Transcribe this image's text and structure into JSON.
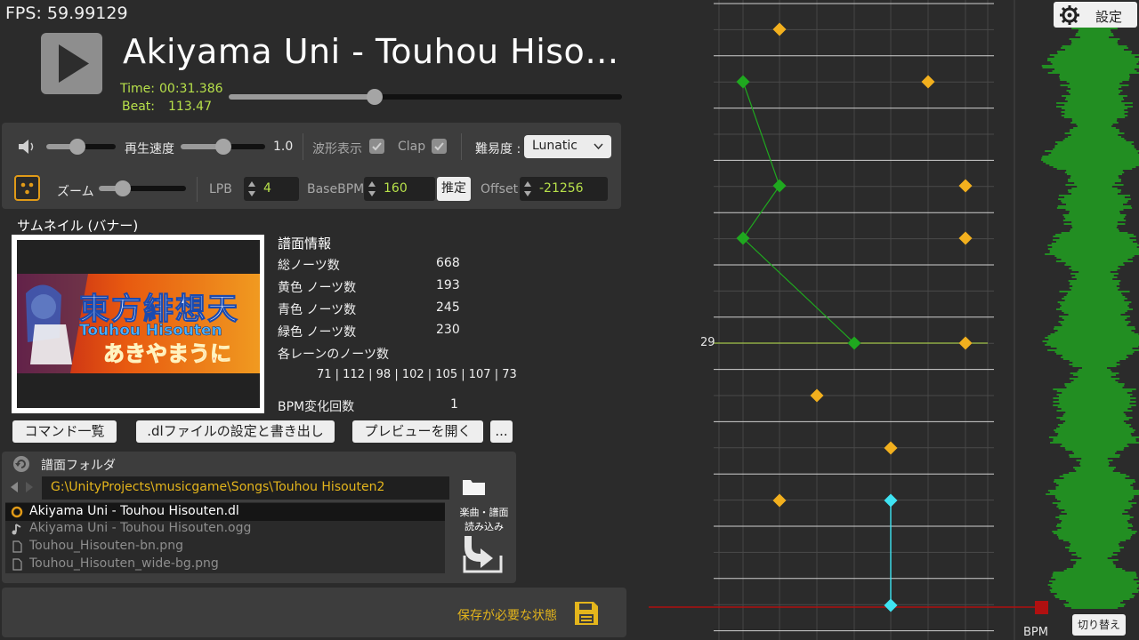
{
  "fps": "FPS: 59.99129",
  "song": {
    "title": "Akiyama Uni - Touhou Hiso…",
    "time_label": "Time:",
    "time_value": "00:31.386",
    "beat_label": "Beat:",
    "beat_value": "113.47",
    "seek_position": 0.37
  },
  "playback": {
    "volume_level": 0.45,
    "speed_label": "再生速度",
    "speed_level": 0.5,
    "speed_value": "1.0",
    "waveform_label": "波形表示",
    "waveform_checked": true,
    "clap_label": "Clap",
    "clap_checked": true,
    "difficulty_label": "難易度 :",
    "difficulty_value": "Lunatic"
  },
  "editor_settings": {
    "zoom_label": "ズーム",
    "zoom_level": 0.28,
    "lpb_label": "LPB",
    "lpb_value": "4",
    "basebpm_label": "BaseBPM",
    "basebpm_value": "160",
    "estimate_label": "推定",
    "offset_label": "Offset",
    "offset_value": "-21256"
  },
  "thumbnail": {
    "label": "サムネイル (バナー)",
    "banner_title": "東方緋想天",
    "banner_subtitle": "Touhou Hisouten",
    "banner_artist": "あきやまうに"
  },
  "chart_info": {
    "title": "譜面情報",
    "rows": [
      {
        "label": "総ノーツ数",
        "value": "668"
      },
      {
        "label": "黄色 ノーツ数",
        "value": "193"
      },
      {
        "label": "青色 ノーツ数",
        "value": "245"
      },
      {
        "label": "緑色 ノーツ数",
        "value": "230"
      }
    ],
    "lane_label": "各レーンのノーツ数",
    "lane_values": "71 | 112 | 98 | 102 | 105 | 107 | 73",
    "bpm_changes_label": "BPM変化回数",
    "bpm_changes_value": "1"
  },
  "actions": {
    "commands": "コマンド一覧",
    "export": ".dlファイルの設定と書き出し",
    "preview": "プレビューを開く",
    "more": "..."
  },
  "folder": {
    "title": "譜面フォルダ",
    "path": "G:\\UnityProjects\\musicgame\\Songs\\Touhou Hisouten2",
    "files": [
      {
        "name": "Akiyama Uni - Touhou Hisouten.dl",
        "icon": "chart-file-icon",
        "selected": true
      },
      {
        "name": "Akiyama Uni - Touhou Hisouten.ogg",
        "icon": "music-note-icon",
        "selected": false
      },
      {
        "name": "Touhou_Hisouten-bn.png",
        "icon": "file-icon",
        "selected": false
      },
      {
        "name": "Touhou_Hisouten_wide-bg.png",
        "icon": "file-icon",
        "selected": false
      }
    ],
    "load_label_line1": "楽曲・譜面",
    "load_label_line2": "読み込み"
  },
  "status": {
    "text": "保存が必要な状態"
  },
  "editor": {
    "settings_label": "設定",
    "toggle_label": "切り替え",
    "bpm_label": "BPM",
    "measure_label": "29"
  },
  "colors": {
    "accent_green": "#b7e04a",
    "accent_yellow": "#e4b51c",
    "note_yellow": "#f2b01e",
    "note_green": "#1fa81f",
    "note_cyan": "#3fe3f2",
    "waveform": "#1fb01f",
    "playhead": "#b01010"
  }
}
